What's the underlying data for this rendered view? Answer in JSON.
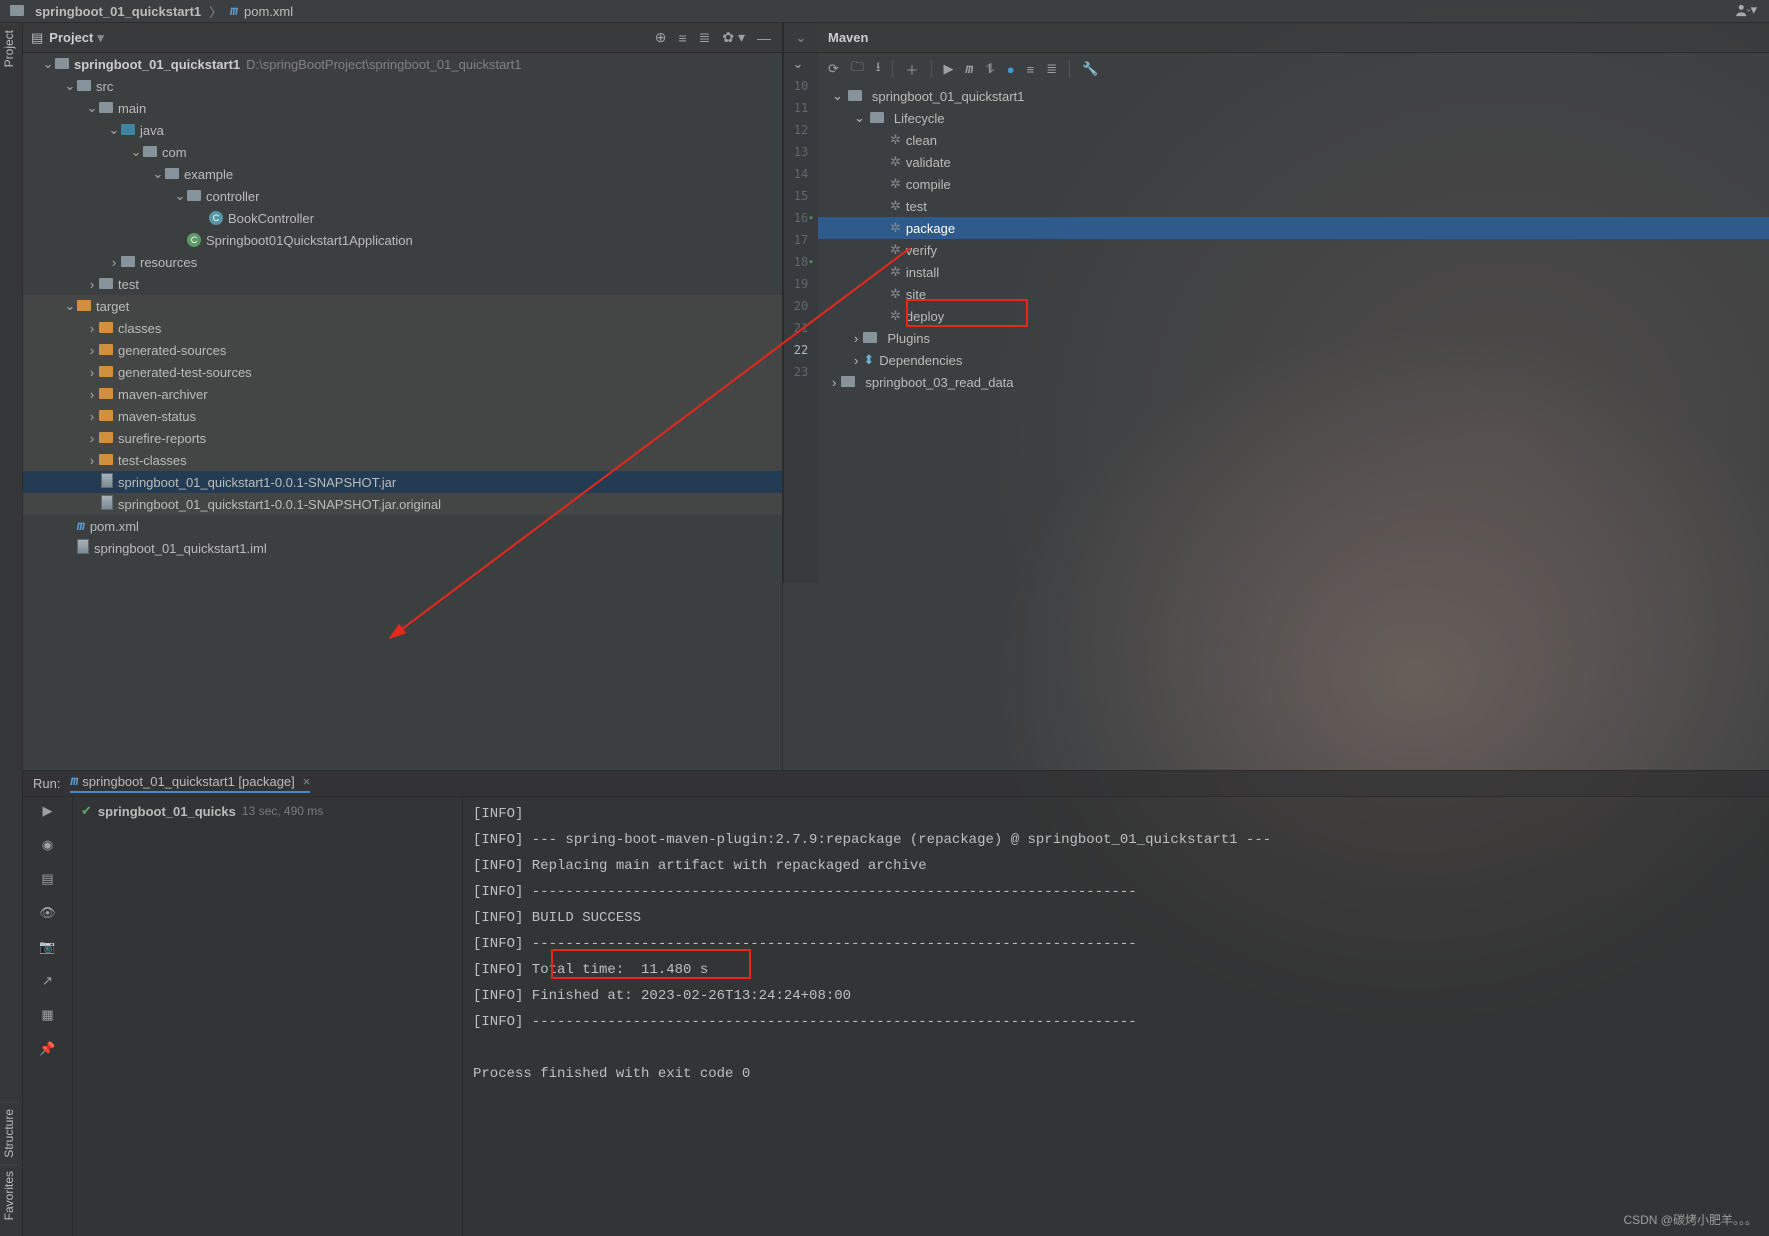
{
  "breadcrumb": {
    "proj": "springboot_01_quickstart1",
    "file": "pom.xml"
  },
  "left_rail": {
    "project": "Project",
    "structure": "Structure",
    "favorites": "Favorites"
  },
  "project_pane": {
    "title": "Project",
    "root": {
      "name": "springboot_01_quickstart1",
      "path": "D:\\springBootProject\\springboot_01_quickstart1"
    },
    "src": "src",
    "main": "main",
    "java": "java",
    "com": "com",
    "example": "example",
    "controller": "controller",
    "book_ctrl": "BookController",
    "app_class": "Springboot01Quickstart1Application",
    "resources": "resources",
    "test": "test",
    "target": "target",
    "target_children": [
      "classes",
      "generated-sources",
      "generated-test-sources",
      "maven-archiver",
      "maven-status",
      "surefire-reports",
      "test-classes"
    ],
    "jar": "springboot_01_quickstart1-0.0.1-SNAPSHOT.jar",
    "jar_orig": "springboot_01_quickstart1-0.0.1-SNAPSHOT.jar.original",
    "pom": "pom.xml",
    "iml": "springboot_01_quickstart1.iml"
  },
  "gutter": {
    "lines": [
      "10",
      "11",
      "12",
      "13",
      "14",
      "15",
      "16",
      "17",
      "18",
      "19",
      "20",
      "21",
      "22",
      "23"
    ],
    "current": "22"
  },
  "maven": {
    "title": "Maven",
    "root": "springboot_01_quickstart1",
    "lifecycle": "Lifecycle",
    "phases": [
      "clean",
      "validate",
      "compile",
      "test",
      "package",
      "verify",
      "install",
      "site",
      "deploy"
    ],
    "selected": "package",
    "plugins": "Plugins",
    "deps": "Dependencies",
    "other_proj": "springboot_03_read_data"
  },
  "run": {
    "label": "Run:",
    "tab": "springboot_01_quickstart1 [package]",
    "task_name": "springboot_01_quicks",
    "task_time": "13 sec, 490 ms",
    "lines": [
      "[INFO]",
      "[INFO] --- spring-boot-maven-plugin:2.7.9:repackage (repackage) @ springboot_01_quickstart1 ---",
      "[INFO] Replacing main artifact with repackaged archive",
      "[INFO] ------------------------------------------------------------------------",
      "[INFO] BUILD SUCCESS",
      "[INFO] ------------------------------------------------------------------------",
      "[INFO] Total time:  11.480 s",
      "[INFO] Finished at: 2023-02-26T13:24:24+08:00",
      "[INFO] ------------------------------------------------------------------------",
      "",
      "Process finished with exit code 0"
    ],
    "success_text": "BUILD SUCCESS"
  },
  "watermark": "CSDN @碳烤小肥羊。。。"
}
